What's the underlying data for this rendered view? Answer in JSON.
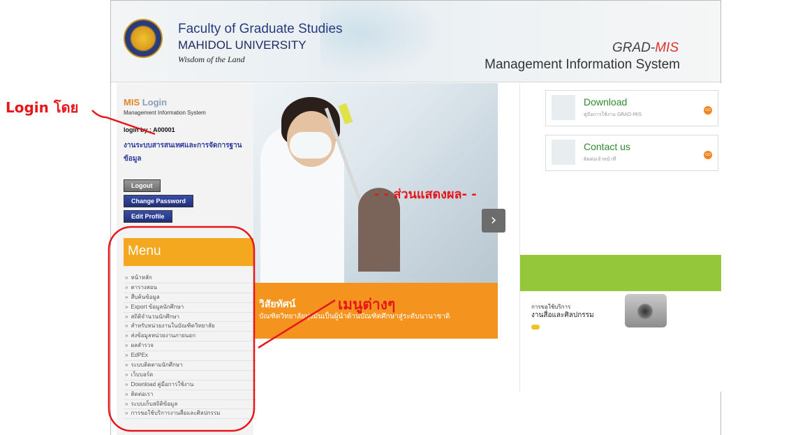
{
  "header": {
    "faculty_line1": "Faculty of Graduate Studies",
    "faculty_line2": "MAHIDOL UNIVERSITY",
    "tagline": "Wisdom of the Land",
    "system_name_prefix": "GRAD-",
    "system_name_suffix": "MIS",
    "system_full": "Management Information System"
  },
  "login_panel": {
    "title_prefix": "MIS",
    "title_suffix": " Login",
    "subtitle": "Management Information System",
    "login_by": "login by : A00001",
    "department": "งานระบบสารสนเทศและการจัดการฐานข้อมูล",
    "logout_label": "Logout",
    "change_password_label": "Change Password",
    "edit_profile_label": "Edit Profile"
  },
  "menu": {
    "title": "Menu",
    "items": [
      "หน้าหลัก",
      "ตารางสอน",
      "สืบค้นข้อมูล",
      "Export ข้อมูลนักศึกษา",
      "สถิติจำนวนนักศึกษา",
      "สำหรับหน่วยงานในบัณฑิตวิทยาลัย",
      "ส่งข้อมูลหน่วยงานภายนอก",
      "ผลสำรวจ",
      "EdPEx",
      "ระบบติดตามนักศึกษา",
      "เว็บบอร์ด",
      "Download คู่มือการใช้งาน",
      "ติดต่อเรา",
      "ระบบเก็บสถิติข้อมูล",
      "การขอใช้บริการงานสื่อและศิลปกรรม"
    ]
  },
  "banner": {
    "title": "วิสัยทัศน์",
    "subtitle": "บัณฑิตวิทยาลัยมุ่งมั่นเป็นผู้นำด้านบัณฑิตศึกษาสู่ระดับนานาชาติ",
    "next_icon": "chevron-right-icon"
  },
  "right_panel": {
    "download_title": "Download",
    "download_sub": "คู่มือการใช้งาน GRAD-MIS",
    "contact_title": "Contact us",
    "contact_sub": "ติดต่อเจ้าหน้าที่",
    "go_label": "GO",
    "service_line1": "การขอใช้บริการ",
    "service_line2": "งานสื่อและศิลปกรรม"
  },
  "annotations": {
    "login": "Login โดย",
    "result": "- - ส่วนแสดงผล- -",
    "menus": "เมนูต่างๆ"
  },
  "colors": {
    "accent_orange": "#f4a81f",
    "banner_orange": "#f4941e",
    "green": "#94c83a",
    "annotation_red": "#e8161b",
    "navy": "#2b3a9c"
  }
}
